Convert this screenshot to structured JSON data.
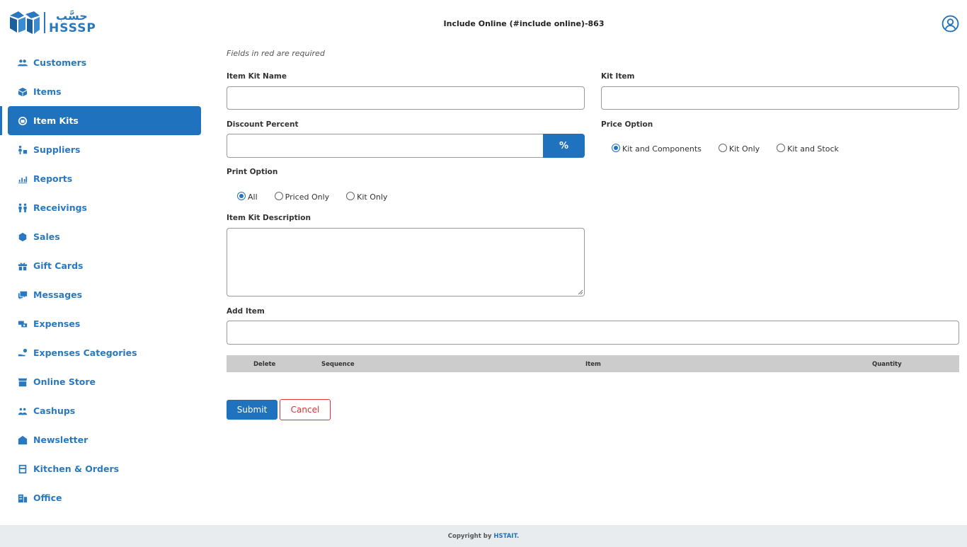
{
  "brand": {
    "logo_ar": "حسَّب",
    "logo_en": "HSSSP",
    "accent": "#1f72bd"
  },
  "header": {
    "title": "Include Online (#include online)-863"
  },
  "sidebar": {
    "items": [
      {
        "label": "Customers",
        "icon": "users-icon"
      },
      {
        "label": "Items",
        "icon": "box-icon"
      },
      {
        "label": "Item Kits",
        "icon": "kit-icon",
        "active": true
      },
      {
        "label": "Suppliers",
        "icon": "supplier-icon"
      },
      {
        "label": "Reports",
        "icon": "chart-icon"
      },
      {
        "label": "Receivings",
        "icon": "people-icon"
      },
      {
        "label": "Sales",
        "icon": "sales-icon"
      },
      {
        "label": "Gift Cards",
        "icon": "gift-icon"
      },
      {
        "label": "Messages",
        "icon": "message-icon"
      },
      {
        "label": "Expenses",
        "icon": "expenses-icon"
      },
      {
        "label": "Expenses Categories",
        "icon": "hand-coin-icon"
      },
      {
        "label": "Online Store",
        "icon": "store-icon"
      },
      {
        "label": "Cashups",
        "icon": "cashups-icon"
      },
      {
        "label": "Newsletter",
        "icon": "newsletter-icon"
      },
      {
        "label": "Kitchen & Orders",
        "icon": "kitchen-icon"
      },
      {
        "label": "Office",
        "icon": "office-icon"
      }
    ]
  },
  "form": {
    "hint": "Fields in red are required",
    "item_kit_name": {
      "label": "Item Kit Name",
      "value": ""
    },
    "kit_item": {
      "label": "Kit Item",
      "value": ""
    },
    "discount_percent": {
      "label": "Discount Percent",
      "value": "",
      "addon": "%"
    },
    "price_option": {
      "label": "Price Option",
      "options": [
        "Kit and Components",
        "Kit Only",
        "Kit and Stock"
      ],
      "selected": 0
    },
    "print_option": {
      "label": "Print Option",
      "options": [
        "All",
        "Priced Only",
        "Kit Only"
      ],
      "selected": 0
    },
    "description": {
      "label": "Item Kit Description",
      "value": ""
    },
    "add_item": {
      "label": "Add Item",
      "value": ""
    },
    "table": {
      "columns": [
        "Delete",
        "Sequence",
        "Item",
        "Quantity"
      ]
    },
    "submit_label": "Submit",
    "cancel_label": "Cancel"
  },
  "footer": {
    "text": "Copyright by",
    "brand": "HSTAIT."
  }
}
